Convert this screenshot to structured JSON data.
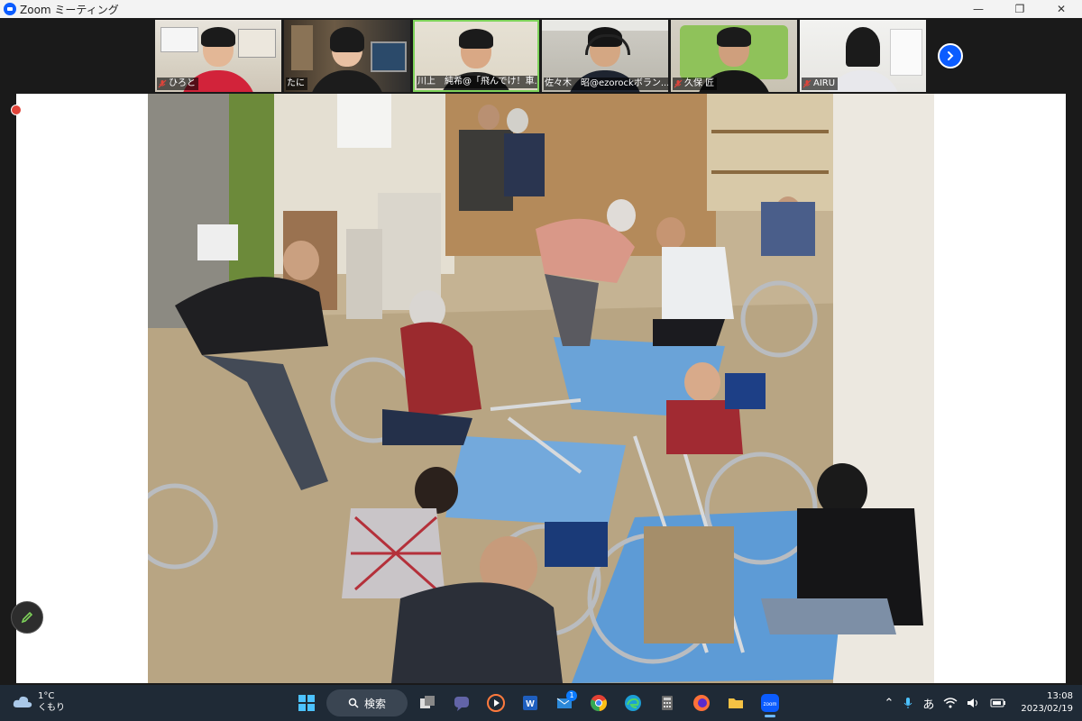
{
  "window": {
    "title": "Zoom ミーティング",
    "controls": [
      "minimize",
      "maximize",
      "close"
    ]
  },
  "participants": [
    {
      "name": "ひろと",
      "muted": true
    },
    {
      "name": "たに",
      "muted": false
    },
    {
      "name": "川上　純希@「飛んでけ！車...",
      "muted": false,
      "active_speaker": true
    },
    {
      "name": "佐々木　昭@ezorockボラン...",
      "muted": false
    },
    {
      "name": "久保 匠",
      "muted": true
    },
    {
      "name": "AIRU",
      "muted": true
    }
  ],
  "shared_screen": {
    "content": "photo",
    "photo_alt": "wheelchair-repair-workshop"
  },
  "taskbar": {
    "weather_temp": "1°C",
    "weather_desc": "くもり",
    "search_label": "検索",
    "mail_badge": "1",
    "ime": "あ",
    "time": "13:08",
    "date": "2023/02/19",
    "zoom_label": "zoom"
  },
  "colors": {
    "zoom_blue": "#0b5cff",
    "active_border": "#7ed35a",
    "taskbar_bg": "#1f2a36",
    "mute_red": "#e0443a"
  }
}
